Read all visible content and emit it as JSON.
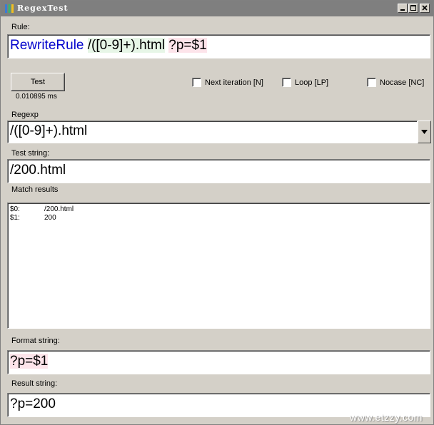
{
  "window": {
    "title": "RegexTest"
  },
  "rule": {
    "label": "Rule:",
    "directive": "RewriteRule",
    "pattern": "/([0-9]+).html",
    "substitution": "?p=$1"
  },
  "test": {
    "button_label": "Test",
    "elapsed": "0.010895 ms"
  },
  "options": [
    {
      "label": "Next iteration [N]",
      "checked": false
    },
    {
      "label": "Loop [LP]",
      "checked": false
    },
    {
      "label": "Nocase [NC]",
      "checked": false
    }
  ],
  "regexp": {
    "label": "Regexp",
    "value": "/([0-9]+).html"
  },
  "test_string": {
    "label": "Test string:",
    "value": "/200.html"
  },
  "match_results": {
    "label": "Match results",
    "rows": [
      {
        "group": "$0:",
        "value": "/200.html"
      },
      {
        "group": "$1:",
        "value": "200"
      }
    ]
  },
  "format_string": {
    "label": "Format string:",
    "value": "?p=$1"
  },
  "result_string": {
    "label": "Result string:",
    "value": "?p=200"
  },
  "watermark": "www.etzzy.com",
  "colors": {
    "titlebar": "#7f7f7f",
    "face": "#d4d0c8",
    "keyword": "#0000cc",
    "pattern_bg": "#e7f6e7",
    "subst_bg": "#fde4ea"
  }
}
